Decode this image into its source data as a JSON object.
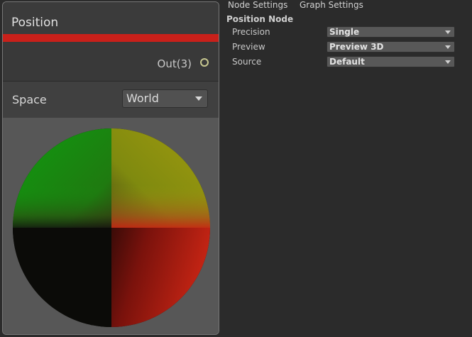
{
  "node": {
    "title": "Position",
    "header_color": "#c9201a",
    "output_port": {
      "label": "Out(3)"
    },
    "space": {
      "label": "Space",
      "value": "World"
    },
    "preview_colors": {
      "background": "#575757",
      "green": "#0f9a0f",
      "yellow": "#9a9a0f",
      "red": "#c82514",
      "dark": "#0b0b08"
    }
  },
  "inspector": {
    "tabs": [
      "Node Settings",
      "Graph Settings"
    ],
    "section_title": "Position Node",
    "settings": [
      {
        "label": "Precision",
        "value": "Single"
      },
      {
        "label": "Preview",
        "value": "Preview 3D"
      },
      {
        "label": "Source",
        "value": "Default"
      }
    ]
  }
}
